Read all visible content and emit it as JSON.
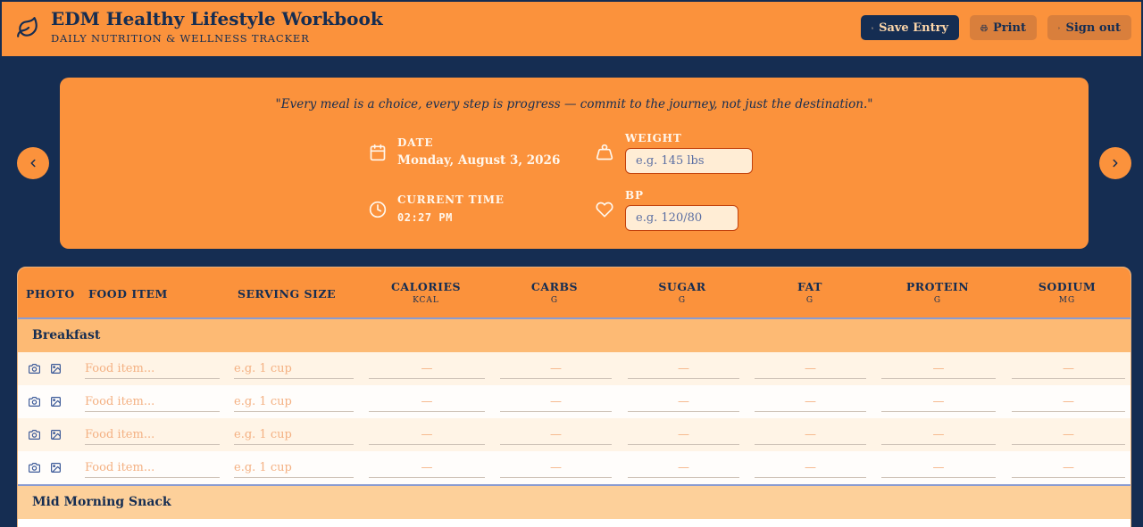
{
  "header": {
    "title": "EDM Healthy Lifestyle Workbook",
    "subtitle": "DAILY NUTRITION & WELLNESS TRACKER",
    "brand_icon": "leaf-icon",
    "save_label": "Save Entry",
    "print_label": "Print",
    "signout_label": "Sign out"
  },
  "hero": {
    "quote": "\"Every meal is a choice, every step is progress — commit to the journey, not just the destination.\"",
    "date_label": "DATE",
    "date_value": "Monday, August 3, 2026",
    "time_label": "CURRENT TIME",
    "time_value": "02:27 PM",
    "weight_label": "WEIGHT",
    "weight_placeholder": "e.g. 145 lbs",
    "bp_label": "BP",
    "bp_placeholder": "e.g. 120/80"
  },
  "table": {
    "columns": {
      "photo": "PHOTO",
      "food": "FOOD ITEM",
      "serving": "SERVING SIZE",
      "calories": "CALORIES",
      "calories_unit": "KCAL",
      "carbs": "CARBS",
      "carbs_unit": "G",
      "sugar": "SUGAR",
      "sugar_unit": "G",
      "fat": "FAT",
      "fat_unit": "G",
      "protein": "PROTEIN",
      "protein_unit": "G",
      "sodium": "SODIUM",
      "sodium_unit": "MG"
    },
    "placeholders": {
      "food": "Food item...",
      "serving": "e.g. 1 cup",
      "number": "—"
    },
    "sections": [
      {
        "name": "Breakfast"
      },
      {
        "name": "Mid Morning Snack"
      }
    ]
  },
  "colors": {
    "navy": "#152d52",
    "orange": "#fb923c",
    "section": "#fdba74"
  }
}
